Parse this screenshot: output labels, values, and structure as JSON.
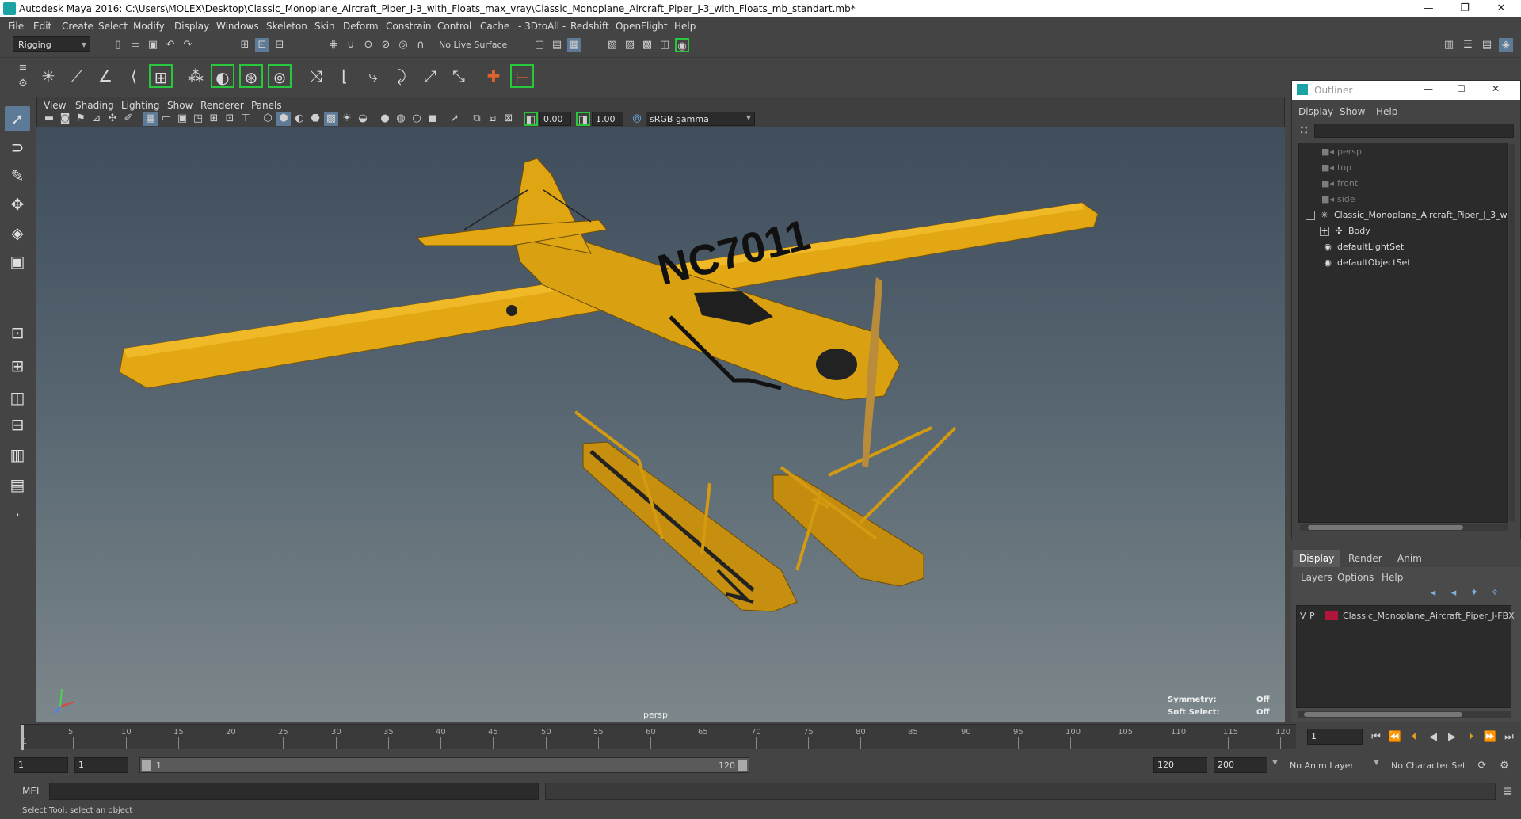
{
  "window": {
    "title": "Autodesk Maya 2016: C:\\Users\\MOLEX\\Desktop\\Classic_Monoplane_Aircraft_Piper_J-3_with_Floats_max_vray\\Classic_Monoplane_Aircraft_Piper_J-3_with_Floats_mb_standart.mb*",
    "minimize": "—",
    "restore": "❐",
    "close": "✕"
  },
  "menubar": [
    "File",
    "Edit",
    "Create",
    "Select",
    "Modify",
    "Display",
    "Windows",
    "Skeleton",
    "Skin",
    "Deform",
    "Constrain",
    "Control",
    "Cache",
    "- 3DtoAll -",
    "Redshift",
    "OpenFlight",
    "Help"
  ],
  "statusline": {
    "menuset": "Rigging",
    "live_surface": "No Live Surface"
  },
  "panel": {
    "menus": [
      "View",
      "Shading",
      "Lighting",
      "Show",
      "Renderer",
      "Panels"
    ],
    "exposure": "0.00",
    "gamma": "1.00",
    "colorspace": "sRGB gamma",
    "camera_label": "persp",
    "hud": {
      "symmetry_label": "Symmetry:",
      "symmetry_value": "Off",
      "soft_select_label": "Soft Select:",
      "soft_select_value": "Off"
    },
    "tail_number": "NC7011"
  },
  "outliner": {
    "title": "Outliner",
    "menus": [
      "Display",
      "Show",
      "Help"
    ],
    "items": [
      {
        "label": "persp",
        "icon": "camera-icon",
        "dim": true,
        "indent": 1
      },
      {
        "label": "top",
        "icon": "camera-icon",
        "dim": true,
        "indent": 1
      },
      {
        "label": "front",
        "icon": "camera-icon",
        "dim": true,
        "indent": 1
      },
      {
        "label": "side",
        "icon": "camera-icon",
        "dim": true,
        "indent": 1
      },
      {
        "label": "Classic_Monoplane_Aircraft_Piper_J_3_w",
        "icon": "locator-icon",
        "dim": false,
        "indent": 1,
        "expand": "−"
      },
      {
        "label": "Body",
        "icon": "mesh-icon",
        "dim": false,
        "indent": 2,
        "expand": "+"
      },
      {
        "label": "defaultLightSet",
        "icon": "set-icon",
        "dim": false,
        "indent": 1
      },
      {
        "label": "defaultObjectSet",
        "icon": "set-icon",
        "dim": false,
        "indent": 1
      }
    ]
  },
  "layers": {
    "tabs": [
      "Display",
      "Render",
      "Anim"
    ],
    "menus": [
      "Layers",
      "Options",
      "Help"
    ],
    "row": {
      "v": "V",
      "p": "P",
      "name": "Classic_Monoplane_Aircraft_Piper_J-FBX",
      "color": "#b0163a"
    }
  },
  "timeline": {
    "ticks": [
      "5",
      "10",
      "15",
      "20",
      "25",
      "30",
      "35",
      "40",
      "45",
      "50",
      "55",
      "60",
      "65",
      "70",
      "75",
      "80",
      "85",
      "90",
      "95",
      "100",
      "105",
      "110",
      "115",
      "120"
    ],
    "first": "1",
    "current_frame": "1"
  },
  "range": {
    "start": "1",
    "playback_start": "1",
    "slider_start": "1",
    "slider_end": "120",
    "playback_end": "120",
    "end": "200",
    "anim_layer": "No Anim Layer",
    "character_set": "No Character Set"
  },
  "cmdline": {
    "label": "MEL"
  },
  "helpline": {
    "text": "Select Tool: select an object"
  },
  "colors": {
    "accent": "#5d7b97",
    "highlight": "#27c83b",
    "plane": "#e2a712"
  }
}
